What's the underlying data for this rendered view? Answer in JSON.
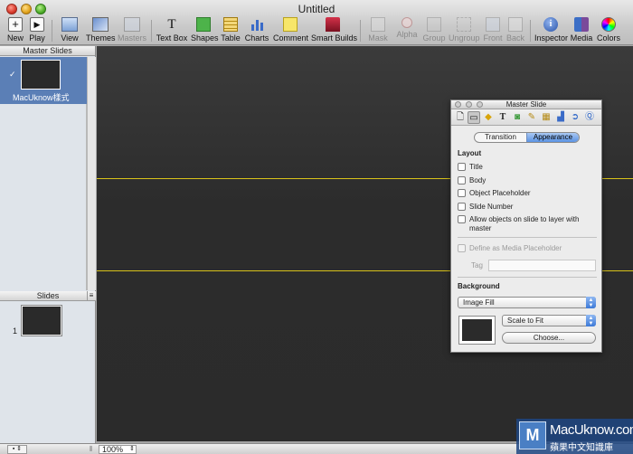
{
  "window": {
    "title": "Untitled"
  },
  "toolbar": {
    "new": "New",
    "play": "Play",
    "view": "View",
    "themes": "Themes",
    "masters": "Masters",
    "textbox": "Text Box",
    "shapes": "Shapes",
    "table": "Table",
    "charts": "Charts",
    "comment": "Comment",
    "smartbuilds": "Smart Builds",
    "mask": "Mask",
    "alpha": "Alpha",
    "group": "Group",
    "ungroup": "Ungroup",
    "front": "Front",
    "back": "Back",
    "inspector": "Inspector",
    "media": "Media",
    "colors": "Colors"
  },
  "left_panel": {
    "master_header": "Master Slides",
    "master_item_label": "MacUknow樣式",
    "slides_header": "Slides",
    "slide_number": "1"
  },
  "bottom_bar": {
    "zoom": "100%"
  },
  "inspector": {
    "title": "Master Slide",
    "segments": [
      "Transition",
      "Appearance"
    ],
    "layout_title": "Layout",
    "layout_options": [
      "Title",
      "Body",
      "Object Placeholder",
      "Slide Number"
    ],
    "allow_objects_label": "Allow objects on slide to layer with master",
    "media_placeholder_label": "Define as Media Placeholder",
    "tag_label": "Tag",
    "background_title": "Background",
    "fill_type": "Image Fill",
    "scale_mode": "Scale to Fit",
    "choose_label": "Choose..."
  },
  "watermark": {
    "line1": "MacUknow.com",
    "line2": "蘋果中文知識庫"
  },
  "colors": {
    "slide_bg": "#2b2b2b",
    "guide": "#d8c21a",
    "selection": "#5b7fb6"
  }
}
